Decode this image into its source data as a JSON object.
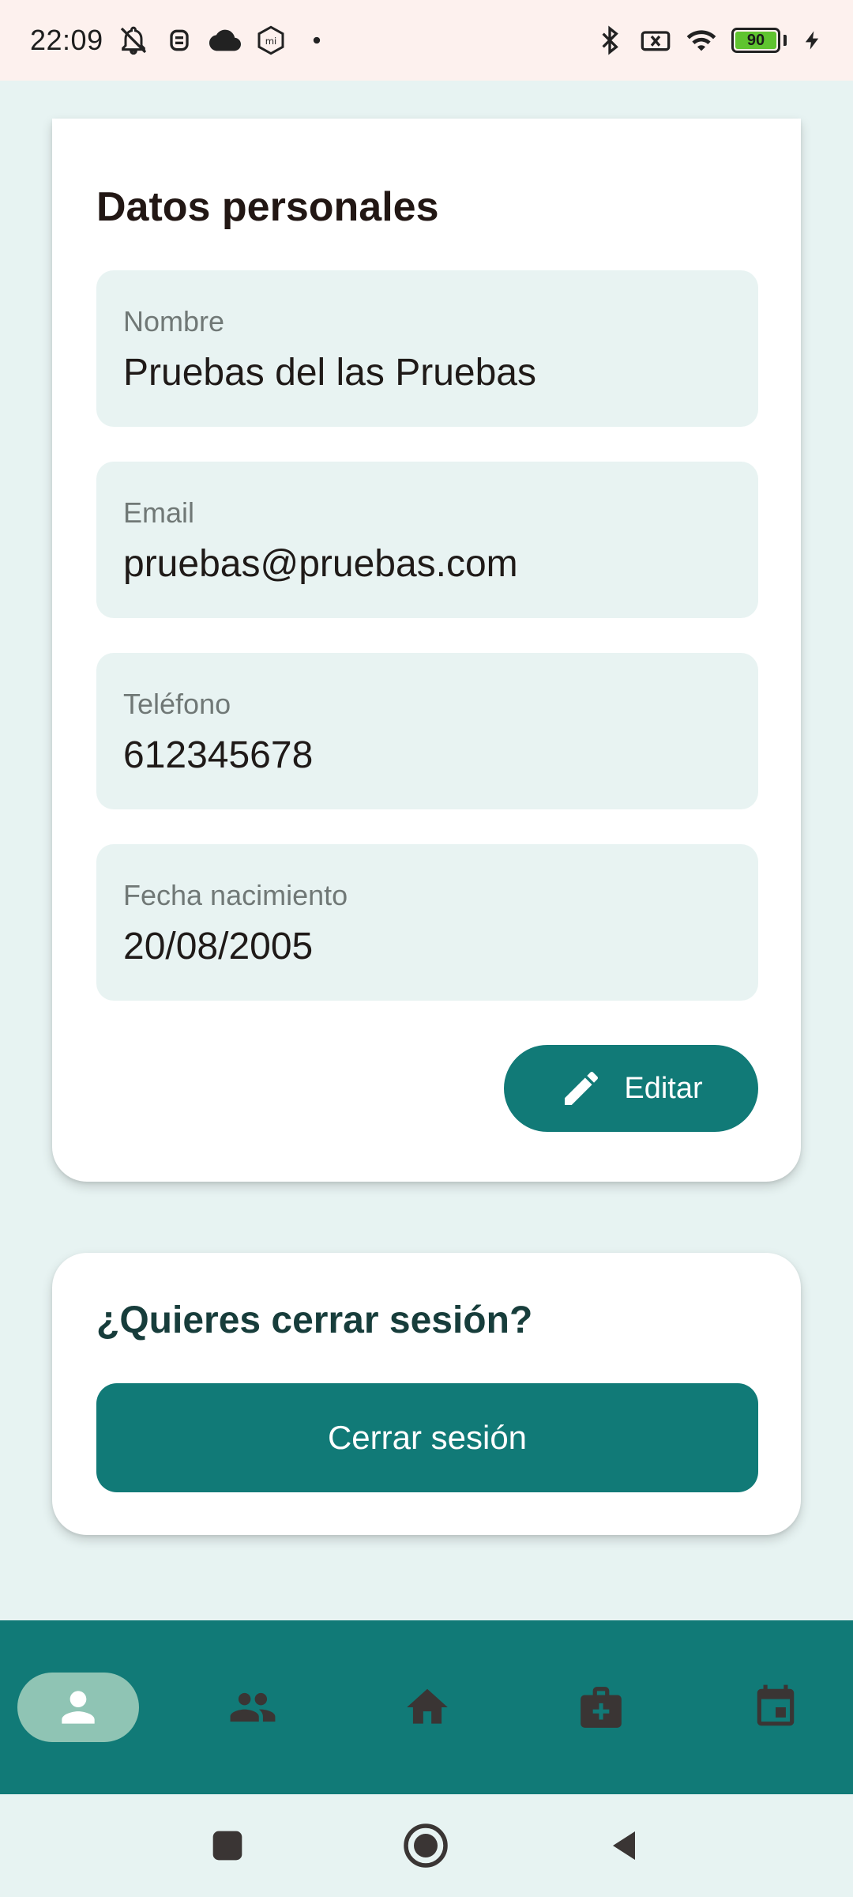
{
  "status_bar": {
    "time": "22:09",
    "battery_level": "90",
    "icons_left": [
      "notifications-off-icon",
      "robot-icon",
      "cloud-icon",
      "mi-icon",
      "dot-icon"
    ],
    "icons_right": [
      "bluetooth-icon",
      "no-sim-icon",
      "wifi-icon",
      "battery-icon",
      "charging-icon"
    ]
  },
  "personal_data": {
    "title": "Datos personales",
    "fields": [
      {
        "label": "Nombre",
        "value": "Pruebas del las Pruebas"
      },
      {
        "label": "Email",
        "value": "pruebas@pruebas.com"
      },
      {
        "label": "Teléfono",
        "value": "612345678"
      },
      {
        "label": "Fecha nacimiento",
        "value": "20/08/2005"
      }
    ],
    "edit_label": "Editar"
  },
  "logout": {
    "title": "¿Quieres cerrar sesión?",
    "button_label": "Cerrar sesión"
  },
  "bottom_nav": {
    "items": [
      "profile-icon",
      "people-icon",
      "home-icon",
      "medical-kit-icon",
      "calendar-icon"
    ],
    "active": "profile-icon"
  },
  "colors": {
    "primary": "#117a77",
    "background": "#e7f3f2",
    "field_background": "#e8f3f2",
    "active_nav_pill": "#8fc4b4",
    "status_bar": "#fdf1ee"
  }
}
